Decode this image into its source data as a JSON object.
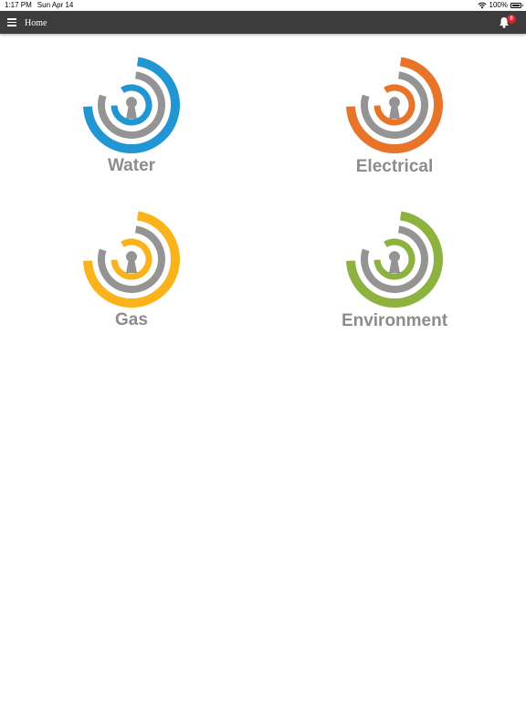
{
  "status_bar": {
    "time": "1:17 PM",
    "date": "Sun Apr 14",
    "battery": "100%",
    "icons": [
      "wifi-icon",
      "battery-icon"
    ]
  },
  "app_bar": {
    "title": "Home",
    "menu_icon": "hamburger-menu-icon",
    "notification_icon": "bell-icon",
    "notification_count": "0",
    "badge_color": "#d9232d"
  },
  "tiles": [
    {
      "label": "Water",
      "icon": "water-logo-icon",
      "color": "#2196d3"
    },
    {
      "label": "Electrical",
      "icon": "electrical-logo-icon",
      "color": "#e8742a"
    },
    {
      "label": "Gas",
      "icon": "gas-logo-icon",
      "color": "#fbb31b"
    },
    {
      "label": "Environment",
      "icon": "environment-logo-icon",
      "color": "#8db23f"
    }
  ],
  "colors": {
    "app_bar": "#3c3c3c",
    "logo_gray": "#949494",
    "label_gray": "#8c8c8c"
  }
}
